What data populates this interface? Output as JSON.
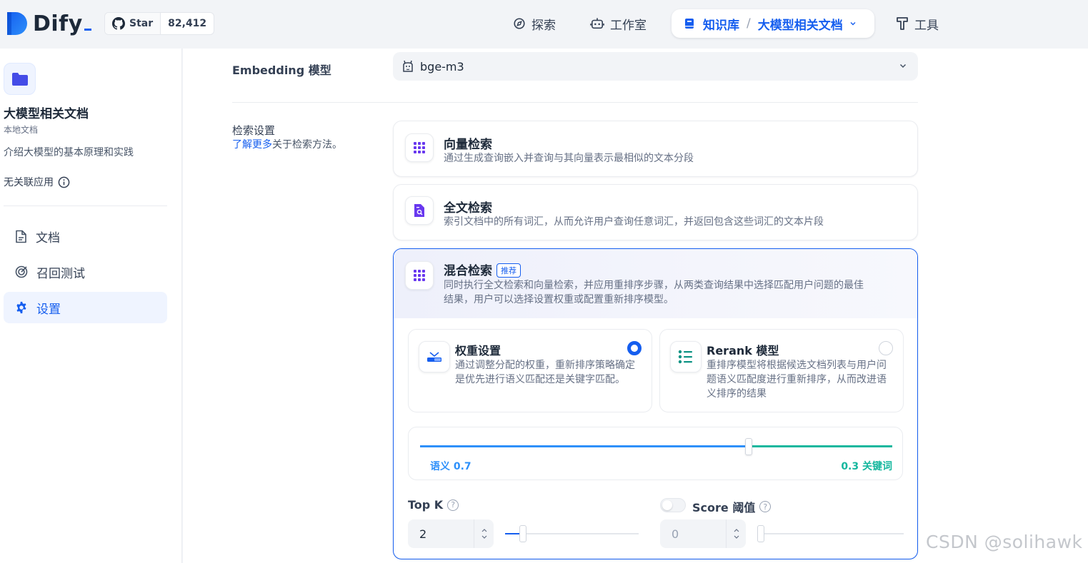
{
  "header": {
    "app_name": "Dify",
    "github": {
      "star_label": "Star",
      "star_count": "82,412"
    },
    "nav": {
      "explore": "探索",
      "studio": "工作室",
      "knowledge": "知识库",
      "current_dataset": "大模型相关文档",
      "tools": "工具"
    }
  },
  "sidebar": {
    "dataset_title": "大模型相关文档",
    "dataset_type": "本地文档",
    "dataset_desc": "介绍大模型的基本原理和实践",
    "linked_apps": "无关联应用",
    "items": [
      {
        "label": "文档",
        "icon": "document-icon"
      },
      {
        "label": "召回测试",
        "icon": "target-icon"
      },
      {
        "label": "设置",
        "icon": "gear-icon",
        "active": true
      }
    ]
  },
  "main": {
    "embedding": {
      "label": "Embedding 模型",
      "model": "bge-m3"
    },
    "retrieval": {
      "label": "检索设置",
      "help_link": "了解更多",
      "help_text": "关于检索方法。",
      "vector": {
        "title": "向量检索",
        "desc": "通过生成查询嵌入并查询与其向量表示最相似的文本分段"
      },
      "fulltext": {
        "title": "全文检索",
        "desc": "索引文档中的所有词汇，从而允许用户查询任意词汇，并返回包含这些词汇的文本片段"
      },
      "hybrid": {
        "title": "混合检索",
        "badge": "推荐",
        "desc_line1": "同时执行全文检索和向量检索，并应用重排序步骤，从两类查询结果中选择匹配用户问题的最佳",
        "desc_line2": "结果，用户可以选择设置权重或配置重新排序模型。",
        "weight_option": {
          "title": "权重设置",
          "desc": "通过调整分配的权重，重新排序策略确定是优先进行语义匹配还是关键字匹配。",
          "selected": true
        },
        "rerank_option": {
          "title": "Rerank 模型",
          "desc": "重排序模型将根据候选文档列表与用户问题语义匹配度进行重新排序，从而改进语义排序的结果",
          "selected": false
        },
        "weights": {
          "semantic_label": "语义 0.7",
          "keyword_label": "0.3 关键词",
          "semantic_value": 0.7
        },
        "top_k": {
          "label": "Top K",
          "value": "2",
          "slider_fraction": 0.13
        },
        "score_threshold": {
          "label": "Score 阈值",
          "value": "0",
          "enabled": false,
          "slider_fraction": 0.0
        }
      }
    }
  },
  "watermark": "CSDN @solihawk",
  "colors": {
    "accent": "#155eef",
    "semantic": "#2e90fa",
    "keyword": "#15b79e"
  }
}
